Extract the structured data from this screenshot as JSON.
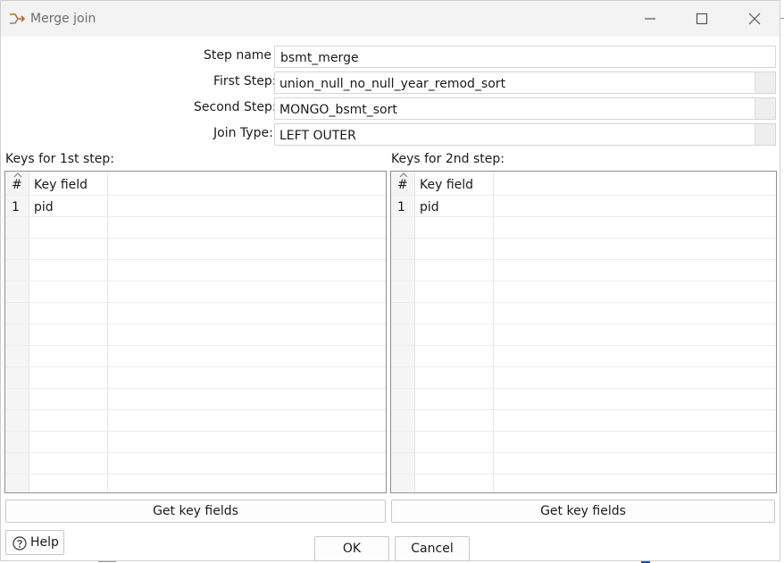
{
  "window": {
    "title": "Merge join"
  },
  "form": {
    "step_name_label": "Step name",
    "step_name_value": "bsmt_merge",
    "first_step_label": "First Step:",
    "first_step_value": "union_null_no_null_year_remod_sort",
    "second_step_label": "Second Step:",
    "second_step_value": "MONGO_bsmt_sort",
    "join_type_label": "Join Type:",
    "join_type_value": "LEFT OUTER"
  },
  "keys1": {
    "label": "Keys for 1st step:",
    "columns": [
      "#",
      "Key field"
    ],
    "rows": [
      {
        "num": "1",
        "key": "pid"
      }
    ],
    "get_button": "Get key fields"
  },
  "keys2": {
    "label": "Keys for 2nd step:",
    "columns": [
      "#",
      "Key field"
    ],
    "rows": [
      {
        "num": "1",
        "key": "pid"
      }
    ],
    "get_button": "Get key fields"
  },
  "buttons": {
    "help": "Help",
    "ok": "OK",
    "cancel": "Cancel"
  },
  "icons": {
    "app": "merge-join-icon",
    "minimize": "minimize-icon",
    "maximize": "maximize-icon",
    "close": "close-icon",
    "help": "help-icon",
    "sort": "sort-arrow-icon"
  }
}
